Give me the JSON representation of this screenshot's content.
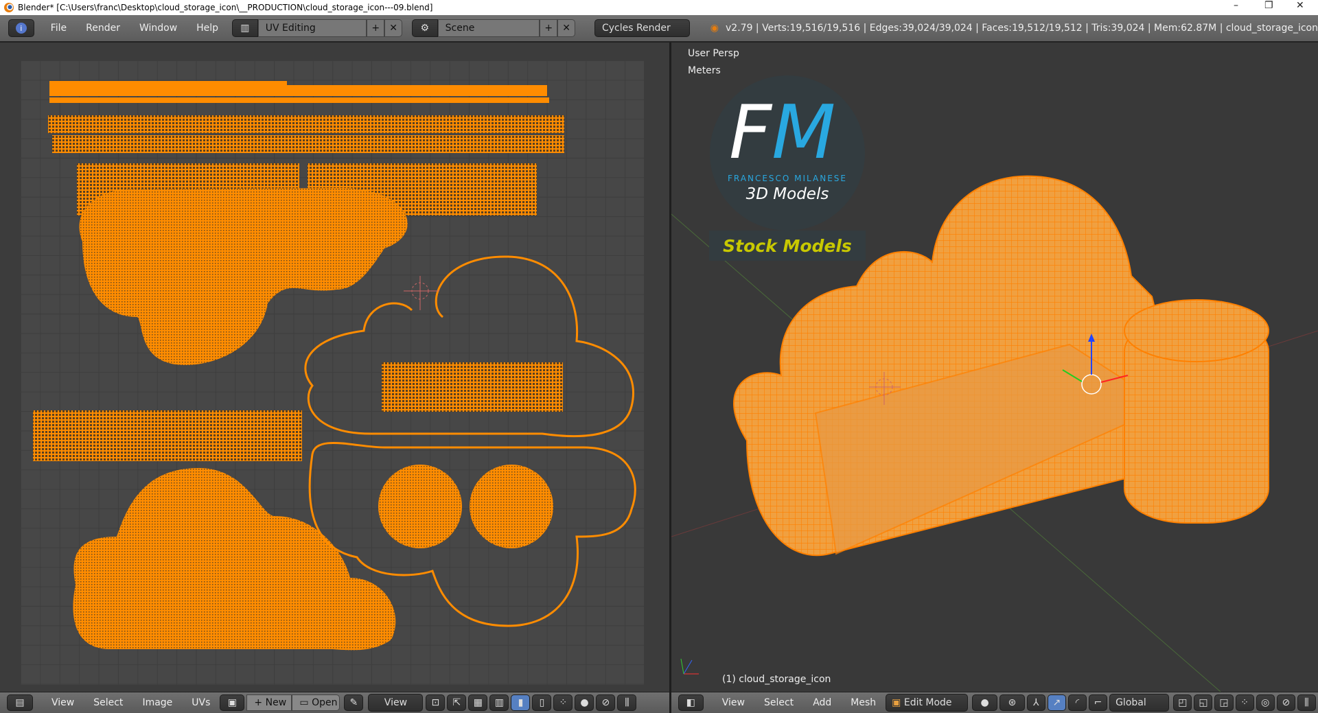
{
  "window": {
    "title": "Blender* [C:\\Users\\franc\\Desktop\\cloud_storage_icon\\__PRODUCTION\\cloud_storage_icon---09.blend]",
    "minimize": "–",
    "restore": "❐",
    "close": "✕"
  },
  "top_header": {
    "menus": [
      "File",
      "Render",
      "Window",
      "Help"
    ],
    "screen_layout": "UV Editing",
    "scene": "Scene",
    "render_engine": "Cycles Render",
    "stats": "v2.79 | Verts:19,516/19,516 | Edges:39,024/39,024 | Faces:19,512/19,512 | Tris:39,024 | Mem:62.87M | cloud_storage_icon"
  },
  "uv_editor": {
    "menus": [
      "View",
      "Select",
      "Image",
      "UVs"
    ],
    "new_label": "New",
    "open_label": "Open",
    "view_label": "View"
  },
  "viewport": {
    "perspective": "User Persp",
    "units": "Meters",
    "object_label": "(1) cloud_storage_icon",
    "menus": [
      "View",
      "Select",
      "Add",
      "Mesh"
    ],
    "mode": "Edit Mode",
    "orientation": "Global"
  },
  "logo": {
    "initial_1": "F",
    "initial_2": "M",
    "brand": "FRANCESCO MILANESE",
    "subtitle": "3D Models",
    "tagline": "Stock Models"
  },
  "colors": {
    "mesh": "#ff8c00",
    "accent_blue": "#29a8e0",
    "tagline": "#c8c800",
    "logo_bg": "#333c40"
  }
}
